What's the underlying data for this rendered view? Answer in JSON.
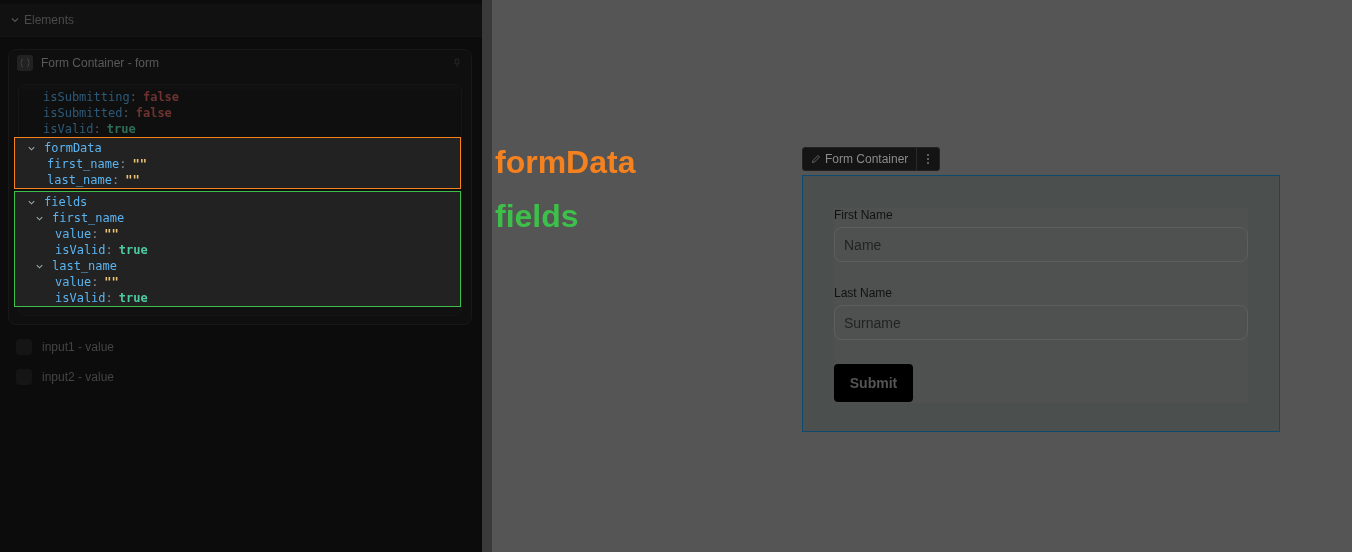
{
  "section": {
    "label": "Elements",
    "expanded": true
  },
  "card": {
    "title": "Form Container - form",
    "tree": [
      {
        "key": "isSubmitting",
        "separator": ":",
        "value": "false",
        "color": "#6e3330",
        "dimmed": true
      },
      {
        "key": "isSubmitted",
        "separator": ":",
        "value": "false",
        "color": "#6e3330",
        "dimmed": true
      },
      {
        "key": "isValid",
        "separator": ":",
        "value": "true",
        "color": "#2e6e58",
        "dimmed": true
      },
      {
        "key": "formData",
        "expanded": true,
        "dimmed": false,
        "callout": {
          "label": "formData",
          "color": "#f5821f"
        },
        "children": [
          {
            "key": "first_name",
            "separator": ":",
            "value": "\"\"",
            "color": "#f0c674",
            "dimmed": false
          },
          {
            "key": "last_name",
            "separator": ":",
            "value": "\"\"",
            "color": "#f0c674",
            "dimmed": false
          }
        ]
      },
      {
        "key": "fields",
        "expanded": true,
        "dimmed": false,
        "callout": {
          "label": "fields",
          "color": "#3dbf4a"
        },
        "children": [
          {
            "key": "first_name",
            "expanded": true,
            "dimmed": false,
            "children": [
              {
                "key": "value",
                "separator": ":",
                "value": "\"\"",
                "color": "#f0c674",
                "dimmed": false
              },
              {
                "key": "isValid",
                "separator": ":",
                "value": "true",
                "color": "#4ec9a0",
                "dimmed": false
              }
            ]
          },
          {
            "key": "last_name",
            "expanded": true,
            "dimmed": false,
            "children": [
              {
                "key": "value",
                "separator": ":",
                "value": "\"\"",
                "color": "#f0c674",
                "dimmed": false
              },
              {
                "key": "isValid",
                "separator": ":",
                "value": "true",
                "color": "#4ec9a0",
                "dimmed": false
              }
            ]
          }
        ]
      }
    ]
  },
  "items": [
    {
      "label": "input1 - value"
    },
    {
      "label": "input2 - value"
    }
  ],
  "canvas": {
    "toolbar": {
      "label": "Form Container"
    },
    "fields": [
      {
        "label": "First Name",
        "placeholder": "Name"
      },
      {
        "label": "Last Name",
        "placeholder": "Surname"
      }
    ],
    "submit": "Submit"
  }
}
